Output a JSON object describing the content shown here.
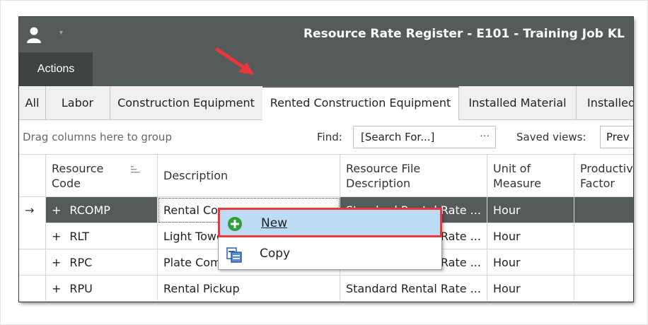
{
  "window": {
    "title": "Resource Rate Register - E101 - Training Job KL"
  },
  "ribbon": {
    "actions_tab": "Actions"
  },
  "tabs": [
    "All",
    "Labor",
    "Construction Equipment",
    "Rented Construction Equipment",
    "Installed Material",
    "Installed"
  ],
  "active_tab_index": 3,
  "toolbar": {
    "group_hint": "Drag columns here to group",
    "find_label": "Find:",
    "search_value": "[Search For...]",
    "search_more": "···",
    "saved_views_label": "Saved views:",
    "saved_views_value": "Prev"
  },
  "grid": {
    "headers": [
      "Resource Code",
      "Description",
      "Resource File Description",
      "Unit of Measure",
      "Productiv Factor"
    ],
    "header_lines": {
      "resource_code": [
        "Resource",
        "Code"
      ],
      "description": [
        "Description"
      ],
      "file_desc": [
        "Resource File",
        "Description"
      ],
      "uom": [
        "Unit of",
        "Measure"
      ],
      "factor": [
        "Productiv",
        "Factor"
      ]
    },
    "rows": [
      {
        "code": "RCOMP",
        "description": "Rental Co",
        "file_desc": "Standard Rental Rate ...",
        "uom": "Hour",
        "factor": ""
      },
      {
        "code": "RLT",
        "description": "Light Towe",
        "file_desc": "Standard Rental Rate ...",
        "uom": "Hour",
        "factor": ""
      },
      {
        "code": "RPC",
        "description": "Plate Com",
        "file_desc": "Standard Rental Rate ...",
        "uom": "Hour",
        "factor": ""
      },
      {
        "code": "RPU",
        "description": "Rental Pickup",
        "file_desc": "Standard Rental Rate ...",
        "uom": "Hour",
        "factor": ""
      }
    ],
    "row_indicator": "→",
    "expand_glyph": "+"
  },
  "context_menu": {
    "items": [
      {
        "label": "New",
        "icon": "add-circle-icon"
      },
      {
        "label": "Copy",
        "icon": "copy-icon"
      }
    ]
  },
  "colors": {
    "titlebar": "#555a5a",
    "highlight_border": "#e8373d",
    "menu_hover": "#bcdcf6",
    "new_icon": "#2e9d3a"
  }
}
